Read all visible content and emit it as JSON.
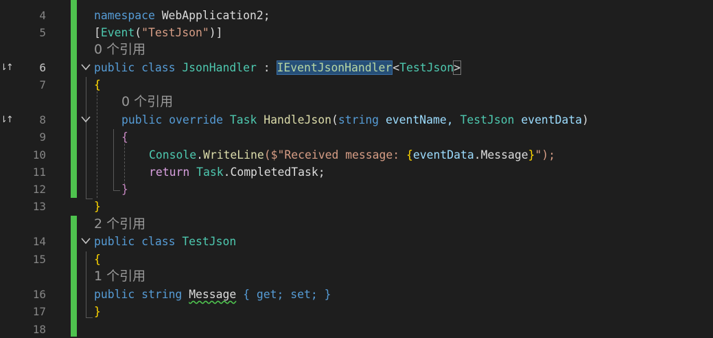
{
  "editor": {
    "line_numbers": [
      "4",
      "5",
      "6",
      "7",
      "8",
      "9",
      "10",
      "11",
      "12",
      "13",
      "14",
      "15",
      "16",
      "17",
      "18"
    ],
    "references": {
      "json_handler": "0 个引用",
      "handle_json": "0 个引用",
      "test_json": "2 个引用",
      "message": "1 个引用"
    },
    "tokens": {
      "namespace_kw": "namespace",
      "namespace_name": "WebApplication2;",
      "attr_open": "[",
      "attr_name": "Event",
      "attr_paren_open": "(",
      "attr_string": "\"TestJson\"",
      "attr_close": ")]",
      "public": "public",
      "class": "class",
      "json_handler": "JsonHandler",
      "colon": ":",
      "iface": "IEventJsonHandler",
      "generic_open": "<",
      "test_json": "TestJson",
      "generic_close": ">",
      "brace_open": "{",
      "brace_close": "}",
      "override": "override",
      "task": "Task",
      "handle_json": "HandleJson",
      "paren_open": "(",
      "string_kw": "string",
      "event_name": "eventName,",
      "event_data": "eventData",
      "paren_close": ")",
      "console": "Console",
      "dot": ".",
      "write_line": "WriteLine",
      "interp_open": "($\"Received message: ",
      "interp_brace_open": "{",
      "event_data_ref": "eventData",
      "message_prop": "Message",
      "interp_brace_close": "}",
      "interp_close": "\");",
      "return": "return",
      "completed_task": "CompletedTask;",
      "test_json_class": "TestJson",
      "message": "Message",
      "get": "get;",
      "set": "set;"
    },
    "gutter_icons": [
      "implementation-up-arrow",
      "implementation-up-arrow"
    ],
    "colors": {
      "background": "#1e1e1e",
      "keyword": "#569cd6",
      "type": "#4ec9b0",
      "string": "#d69d85",
      "method": "#dcdcaa",
      "parameter": "#9cdcfe",
      "selection": "#264f78",
      "change_bar": "#4ec24e"
    }
  }
}
